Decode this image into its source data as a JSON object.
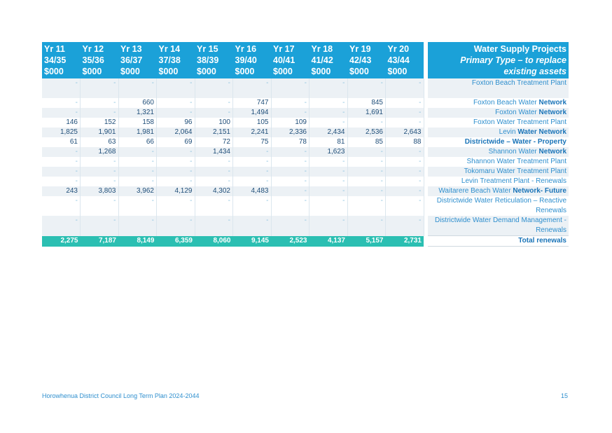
{
  "header": {
    "years": [
      {
        "yr": "Yr 11",
        "span": "34/35",
        "unit": "$000"
      },
      {
        "yr": "Yr 12",
        "span": "35/36",
        "unit": "$000"
      },
      {
        "yr": "Yr 13",
        "span": "36/37",
        "unit": "$000"
      },
      {
        "yr": "Yr 14",
        "span": "37/38",
        "unit": "$000"
      },
      {
        "yr": "Yr 15",
        "span": "38/39",
        "unit": "$000"
      },
      {
        "yr": "Yr 16",
        "span": "39/40",
        "unit": "$000"
      },
      {
        "yr": "Yr 17",
        "span": "40/41",
        "unit": "$000"
      },
      {
        "yr": "Yr 18",
        "span": "41/42",
        "unit": "$000"
      },
      {
        "yr": "Yr 19",
        "span": "42/43",
        "unit": "$000"
      },
      {
        "yr": "Yr 20",
        "span": "43/44",
        "unit": "$000"
      }
    ],
    "project_title": "Water Supply Projects",
    "project_subtitle": "Primary Type – to replace existing assets"
  },
  "rows": [
    {
      "values": [
        "-",
        "-",
        "-",
        "-",
        "-",
        "-",
        "-",
        "-",
        "-",
        "-"
      ],
      "project_pre": "Foxton Beach Treatment Plant",
      "project_bold": "",
      "tall": true
    },
    {
      "values": [
        "-",
        "-",
        "660",
        "-",
        "-",
        "747",
        "-",
        "-",
        "845",
        "-"
      ],
      "project_pre": "Foxton Beach Water ",
      "project_bold": "Network",
      "tall": false
    },
    {
      "values": [
        "-",
        "-",
        "1,321",
        "-",
        "-",
        "1,494",
        "-",
        "-",
        "1,691",
        "-"
      ],
      "project_pre": "Foxton Water ",
      "project_bold": "Network",
      "tall": false
    },
    {
      "values": [
        "146",
        "152",
        "158",
        "96",
        "100",
        "105",
        "109",
        "-",
        "-",
        "-"
      ],
      "project_pre": "Foxton Water Treatment Plant",
      "project_bold": "",
      "tall": false
    },
    {
      "values": [
        "1,825",
        "1,901",
        "1,981",
        "2,064",
        "2,151",
        "2,241",
        "2,336",
        "2,434",
        "2,536",
        "2,643"
      ],
      "project_pre": "Levin ",
      "project_bold": "Water Network",
      "tall": false
    },
    {
      "values": [
        "61",
        "63",
        "66",
        "69",
        "72",
        "75",
        "78",
        "81",
        "85",
        "88"
      ],
      "project_pre": "",
      "project_bold": "Districtwide – Water - Property",
      "tall": false
    },
    {
      "values": [
        "-",
        "1,268",
        "-",
        "-",
        "1,434",
        "-",
        "-",
        "1,623",
        "-",
        "-"
      ],
      "project_pre": "Shannon Water ",
      "project_bold": "Network",
      "tall": false
    },
    {
      "values": [
        "-",
        "-",
        "-",
        "-",
        "-",
        "-",
        "-",
        "-",
        "-",
        "-"
      ],
      "project_pre": "Shannon Water Treatment Plant",
      "project_bold": "",
      "tall": false
    },
    {
      "values": [
        "-",
        "-",
        "-",
        "-",
        "-",
        "-",
        "-",
        "-",
        "-",
        "-"
      ],
      "project_pre": "Tokomaru Water Treatment Plant",
      "project_bold": "",
      "tall": false
    },
    {
      "values": [
        "-",
        "-",
        "-",
        "-",
        "-",
        "-",
        "-",
        "-",
        "-",
        "-"
      ],
      "project_pre": "Levin Treatment Plant - Renewals",
      "project_bold": "",
      "tall": false
    },
    {
      "values": [
        "243",
        "3,803",
        "3,962",
        "4,129",
        "4,302",
        "4,483",
        "-",
        "-",
        "-",
        "-"
      ],
      "project_pre": "Waitarere Beach Water ",
      "project_bold": "Network- Future",
      "tall": false
    },
    {
      "values": [
        "-",
        "-",
        "-",
        "-",
        "-",
        "-",
        "-",
        "-",
        "-",
        "-"
      ],
      "project_pre": "Districtwide Water Reticulation – Reactive Renewals",
      "project_bold": "",
      "tall": true
    },
    {
      "values": [
        "-",
        "-",
        "-",
        "-",
        "-",
        "-",
        "-",
        "-",
        "-",
        "-"
      ],
      "project_pre": "Districtwide Water Demand Management - Renewals",
      "project_bold": "",
      "tall": true
    }
  ],
  "total": {
    "values": [
      "2,275",
      "7,187",
      "8,149",
      "6,359",
      "8,060",
      "9,145",
      "2,523",
      "4,137",
      "5,157",
      "2,731"
    ],
    "label": "Total renewals"
  },
  "footer": {
    "left": "Horowhenua District Council Long Term Plan 2024-2044",
    "page": "15"
  }
}
